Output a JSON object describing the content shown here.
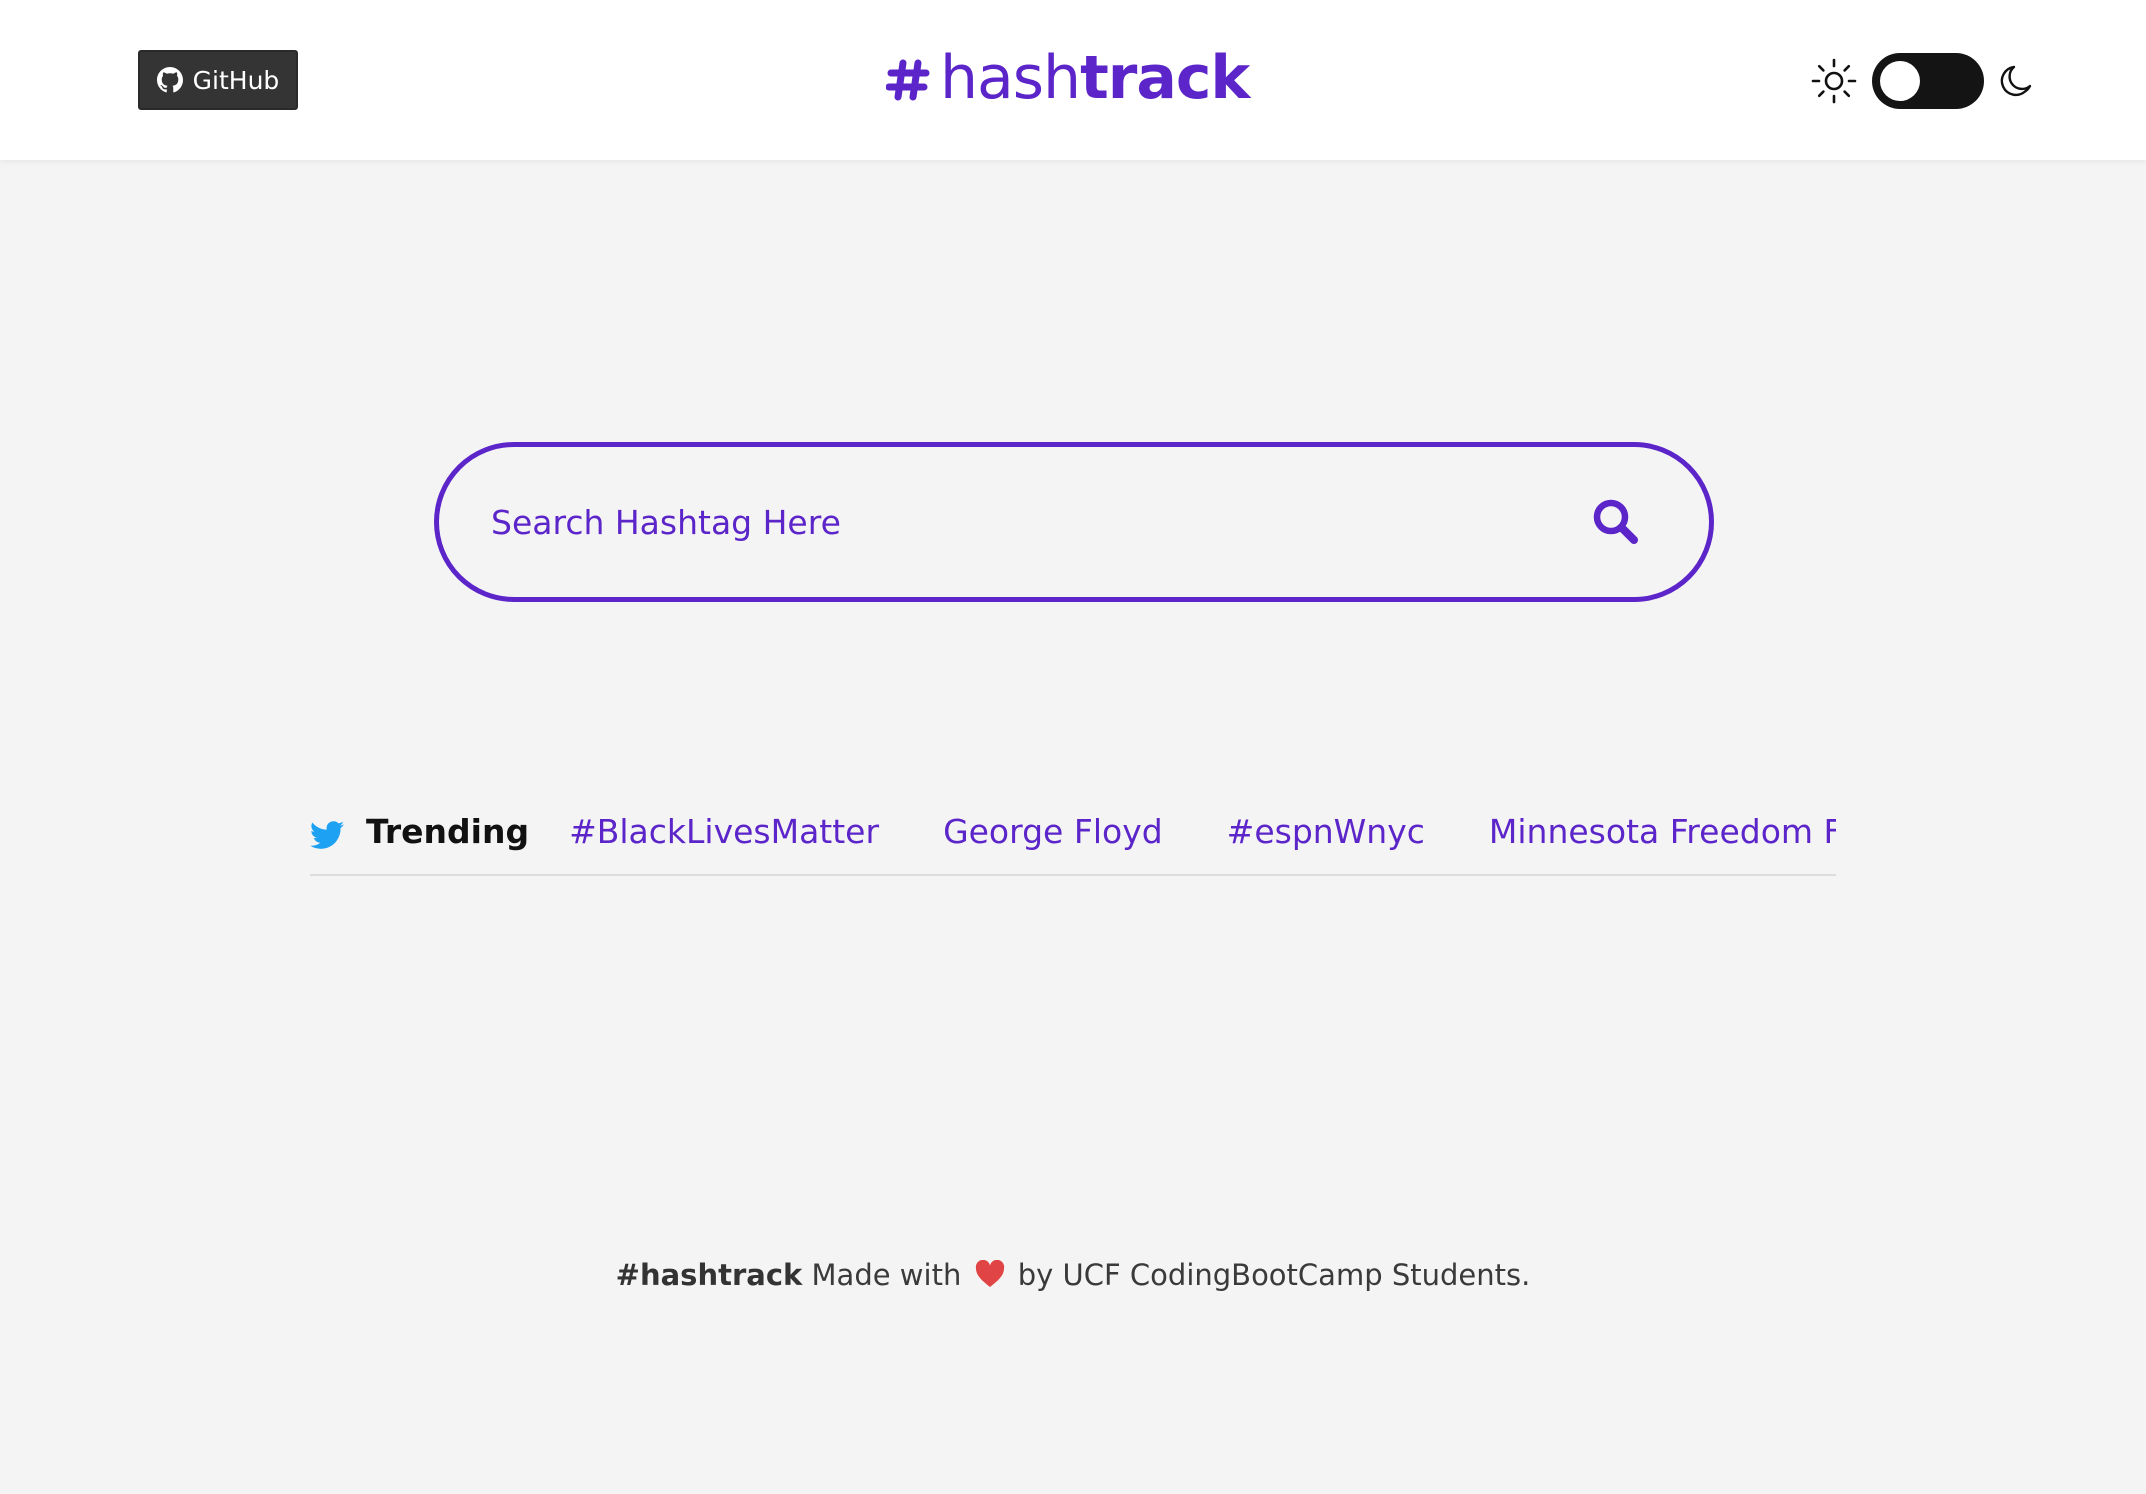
{
  "header": {
    "github_label": "GitHub",
    "logo_light": "hash",
    "logo_bold": "track"
  },
  "theme": {
    "mode": "light",
    "sun_icon": "sun-icon",
    "moon_icon": "moon-icon"
  },
  "search": {
    "placeholder": "Search Hashtag Here",
    "value": ""
  },
  "trending": {
    "label": "Trending",
    "items": [
      "#BlackLivesMatter",
      "George Floyd",
      "#espnWnyc",
      "Minnesota Freedom Fund"
    ]
  },
  "footer": {
    "brand": "#hashtrack",
    "made_with": "Made with",
    "by_text": "by UCF CodingBootCamp Students."
  },
  "colors": {
    "accent": "#5b25c9",
    "background": "#f5f4f5",
    "twitter_blue": "#1da1f2",
    "heart_red": "#e04444"
  }
}
